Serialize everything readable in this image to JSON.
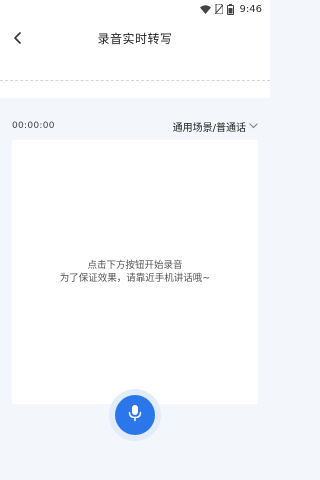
{
  "status_bar": {
    "time": "9:46"
  },
  "header": {
    "title": "录音实时转写"
  },
  "recording": {
    "timer": "00:00:00",
    "scene_label": "通用场景/普通话"
  },
  "transcript": {
    "hint_line1": "点击下方按钮开始录音",
    "hint_line2": "为了保证效果，请靠近手机讲话哦~"
  },
  "colors": {
    "accent": "#2a76ea",
    "mic_ring": "#e3ecfa",
    "background": "#f3f6fb"
  },
  "icons": {
    "back": "back-chevron-icon",
    "dropdown": "chevron-down-icon",
    "mic": "microphone-icon"
  }
}
